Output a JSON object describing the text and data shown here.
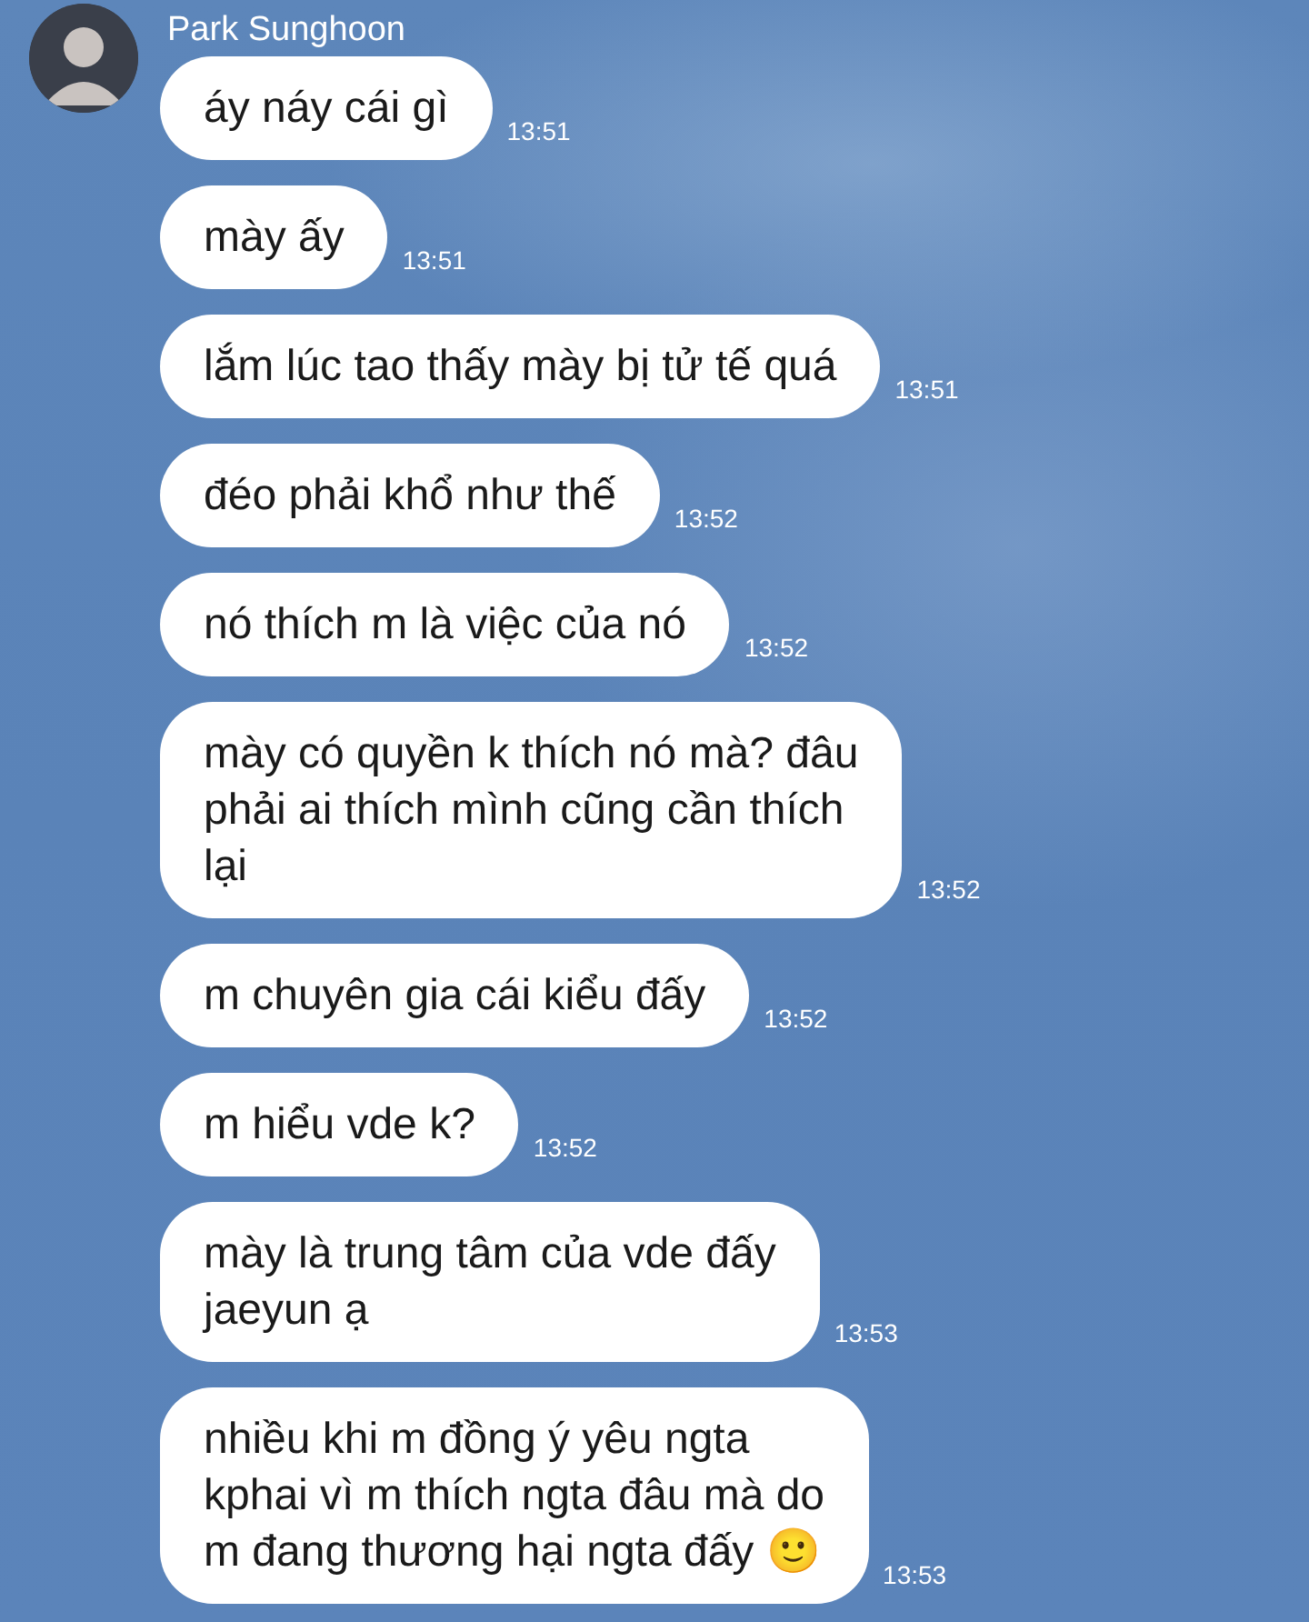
{
  "contact": {
    "name": "Park Sunghoon"
  },
  "messages": [
    {
      "text": "áy náy cái gì",
      "time": "13:51"
    },
    {
      "text": "mày ấy",
      "time": "13:51"
    },
    {
      "text": "lắm lúc tao thấy mày bị tử tế quá",
      "time": "13:51"
    },
    {
      "text": "đéo phải khổ như thế",
      "time": "13:52"
    },
    {
      "text": "nó thích m là việc của nó",
      "time": "13:52"
    },
    {
      "text": "mày có quyền k thích nó mà? đâu\nphải ai thích mình cũng cần thích\nlại",
      "time": "13:52"
    },
    {
      "text": "m chuyên gia cái kiểu đấy",
      "time": "13:52"
    },
    {
      "text": "m hiểu vde k?",
      "time": "13:52"
    },
    {
      "text": "mày là trung tâm của vde đấy\njaeyun ạ",
      "time": "13:53"
    },
    {
      "text": "nhiều khi m đồng ý yêu ngta\nkphai vì m thích ngta đâu mà do\nm đang thương hại ngta đấy 🙂",
      "time": "13:53"
    }
  ]
}
